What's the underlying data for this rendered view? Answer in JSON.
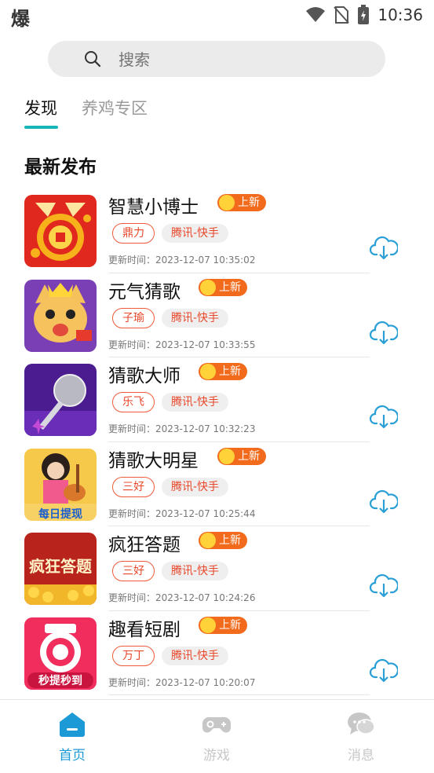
{
  "status_bar": {
    "left_glyph": "爆",
    "time": "10:36"
  },
  "search": {
    "placeholder": "搜索"
  },
  "tabs": [
    {
      "label": "发现",
      "active": true
    },
    {
      "label": "养鸡专区",
      "active": false
    }
  ],
  "section_title": "最新发布",
  "badge_new": "上新",
  "games": [
    {
      "name": "智慧小博士",
      "author": "鼎力",
      "platform": "腾讯-快手",
      "updated": "更新时间：2023-12-07 10:35:02",
      "thumb": "answer-coin"
    },
    {
      "name": "元气猜歌",
      "author": "子瑜",
      "platform": "腾讯-快手",
      "updated": "更新时间：2023-12-07 10:33:55",
      "thumb": "singing-cat"
    },
    {
      "name": "猜歌大师",
      "author": "乐飞",
      "platform": "腾讯-快手",
      "updated": "更新时间：2023-12-07 10:32:23",
      "thumb": "microphone"
    },
    {
      "name": "猜歌大明星",
      "author": "三好",
      "platform": "腾讯-快手",
      "updated": "更新时间：2023-12-07 10:25:44",
      "thumb": "guitar-girl",
      "thumb_text": "每日提现"
    },
    {
      "name": "疯狂答题",
      "author": "三好",
      "platform": "腾讯-快手",
      "updated": "更新时间：2023-12-07 10:24:26",
      "thumb": "crazy-quiz",
      "thumb_text": "疯狂答题"
    },
    {
      "name": "趣看短剧",
      "author": "万丁",
      "platform": "腾讯-快手",
      "updated": "更新时间：2023-12-07 10:20:07",
      "thumb": "camera-red",
      "thumb_text": "秒提秒到"
    }
  ],
  "bottom_nav": [
    {
      "label": "首页",
      "icon": "home-icon",
      "active": true
    },
    {
      "label": "游戏",
      "icon": "gamepad-icon",
      "active": false
    },
    {
      "label": "消息",
      "icon": "chat-icon",
      "active": false
    }
  ],
  "colors": {
    "accent": "#18b6b9",
    "nav_active": "#1b9ad6",
    "nav_inactive": "#c7c7c7",
    "badge": "#f26a1b",
    "tag_text": "#e8472a",
    "download": "#2a9fd6"
  }
}
